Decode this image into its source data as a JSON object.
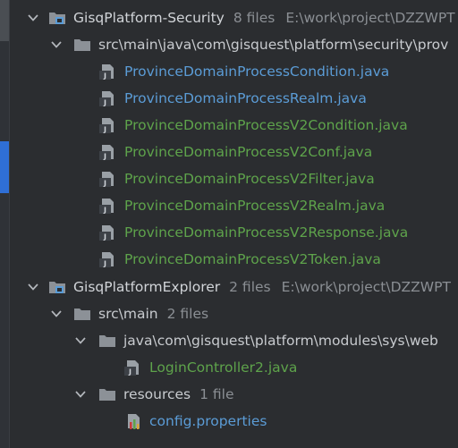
{
  "colors": {
    "background": "#2b2d30",
    "accent": "#2f6fd6",
    "text": "#d1d4d8",
    "secondary_text": "#8b8f94",
    "modified_file": "#5b9cd6",
    "new_file": "#5ea34b"
  },
  "tree": {
    "module_security": {
      "name": "GisqPlatform-Security",
      "count": "8 files",
      "path": "E:\\work\\project\\DZZWPT"
    },
    "security_pkg": {
      "name": "src\\main\\java\\com\\gisquest\\platform\\security\\prov"
    },
    "security_files": [
      {
        "name": "ProvinceDomainProcessCondition.java"
      },
      {
        "name": "ProvinceDomainProcessRealm.java"
      },
      {
        "name": "ProvinceDomainProcessV2Condition.java"
      },
      {
        "name": "ProvinceDomainProcessV2Conf.java"
      },
      {
        "name": "ProvinceDomainProcessV2Filter.java"
      },
      {
        "name": "ProvinceDomainProcessV2Realm.java"
      },
      {
        "name": "ProvinceDomainProcessV2Response.java"
      },
      {
        "name": "ProvinceDomainProcessV2Token.java"
      }
    ],
    "module_explorer": {
      "name": "GisqPlatformExplorer",
      "count": "2 files",
      "path": "E:\\work\\project\\DZZWPT"
    },
    "src_main": {
      "name": "src\\main",
      "count": "2 files"
    },
    "web_pkg": {
      "name": "java\\com\\gisquest\\platform\\modules\\sys\\web"
    },
    "web_files": [
      {
        "name": "LoginController2.java"
      }
    ],
    "resources": {
      "name": "resources",
      "count": "1 file"
    },
    "resource_files": [
      {
        "name": "config.properties"
      }
    ]
  }
}
